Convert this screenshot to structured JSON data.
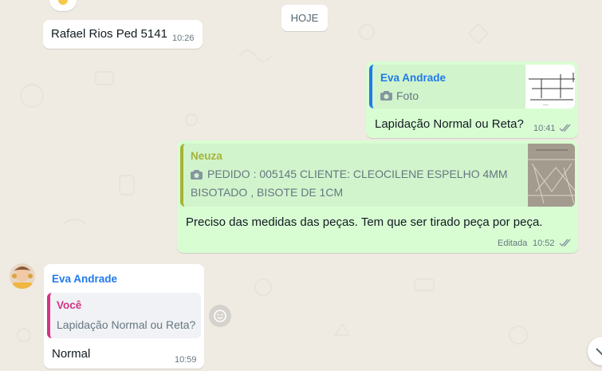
{
  "date_divider": "HOJE",
  "messages": [
    {
      "text": "Rafael Rios Ped 5141",
      "time": "10:26"
    },
    {
      "quote_author": "Eva Andrade",
      "quote_text": "Foto",
      "text": "Lapidação Normal ou Reta?",
      "time": "10:41"
    },
    {
      "quote_author": "Neuza",
      "quote_text_line1": "PEDIDO : 005145 CLIENTE: CLEOCILENE ESPELHO 4MM",
      "quote_text_line2": "BISOTADO , BISOTE DE 1CM",
      "text": "Preciso das medidas das peças. Tem que ser tirado peça por peça.",
      "edited_label": "Editada",
      "time": "10:52"
    },
    {
      "sender": "Eva Andrade",
      "quote_author": "Você",
      "quote_text": "Lapidação Normal ou Reta?",
      "text": "Normal",
      "time": "10:59"
    }
  ],
  "icons": {
    "camera": "camera-icon",
    "ticks": "double-check-icon",
    "emoji": "emoji-icon",
    "scroll": "chevron-down-icon"
  },
  "colors": {
    "eva_author": "#1f7aec",
    "neuza_author": "#a5b337",
    "voce_author": "#d63384",
    "ticks": "#8696a0"
  }
}
